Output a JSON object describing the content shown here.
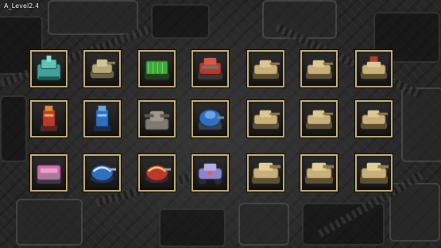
{
  "hud": {
    "level_label": "A_Level2.4"
  },
  "unit_grid": {
    "rows": [
      [
        {
          "kind": "turret-teal"
        },
        {
          "kind": "tank-khaki-small"
        },
        {
          "kind": "tank-green-launcher"
        },
        {
          "kind": "tank-red-armored"
        },
        {
          "kind": "tank-desert"
        },
        {
          "kind": "tank-desert"
        },
        {
          "kind": "tank-desert-red-flag"
        }
      ],
      [
        {
          "kind": "tower-red"
        },
        {
          "kind": "tower-blue"
        },
        {
          "kind": "bunker-gray"
        },
        {
          "kind": "dome-blue"
        },
        {
          "kind": "tank-desert"
        },
        {
          "kind": "tank-desert"
        },
        {
          "kind": "tank-desert"
        }
      ],
      [
        {
          "kind": "truck-pink"
        },
        {
          "kind": "pod-blue"
        },
        {
          "kind": "pod-red"
        },
        {
          "kind": "rover-purple"
        },
        {
          "kind": "tank-desert-heavy"
        },
        {
          "kind": "tank-desert-heavy"
        },
        {
          "kind": "tank-desert-heavy"
        }
      ]
    ]
  },
  "palette": {
    "tile_border": "#c9b27c",
    "teal": "#3fa39a",
    "khaki": "#b7a878",
    "green": "#3fa83a",
    "red": "#b83a2e",
    "desert": "#c9b07a",
    "blue": "#2f6fc0",
    "gray": "#7d7a72",
    "pink": "#d06aa8",
    "purple": "#8f86c9"
  }
}
